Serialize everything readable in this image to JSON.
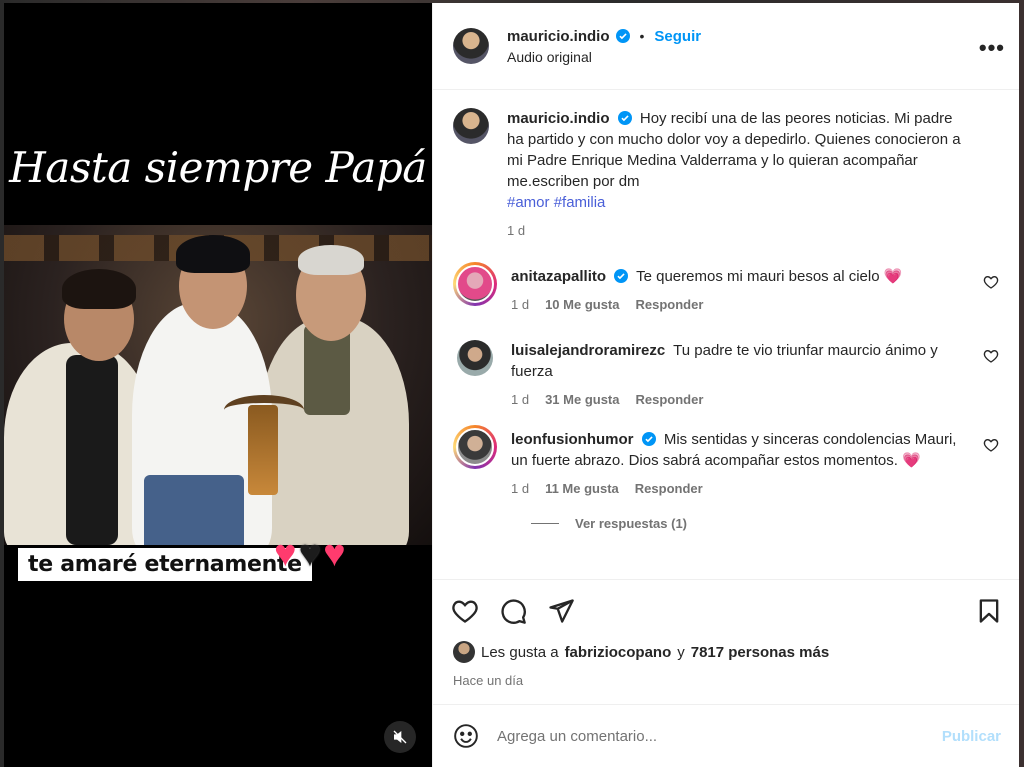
{
  "media": {
    "title": "Hasta siempre Papá",
    "caption_strip": "te amaré eternamente",
    "hearts": [
      "♥",
      "♥",
      "♥"
    ],
    "heart_colors": [
      "#ff3b6e",
      "#1c1c1c",
      "#ff3b6e"
    ]
  },
  "header": {
    "username": "mauricio.indio",
    "follow_label": "Seguir",
    "subline": "Audio original",
    "more_label": "•••"
  },
  "post": {
    "username": "mauricio.indio",
    "text": "Hoy recibí una de las peores noticias. Mi padre ha partido y con mucho dolor voy a depedirlo. Quienes conocieron a mi Padre Enrique Medina Valderrama y lo quieran acompañar me.escriben por dm",
    "tags": [
      "#amor",
      "#familia"
    ],
    "time": "1 d"
  },
  "comments": [
    {
      "username": "anitazapallito",
      "verified": true,
      "text": "Te queremos mi mauri besos al cielo",
      "emoji": "💗",
      "time": "1 d",
      "likes": "10 Me gusta",
      "reply": "Responder"
    },
    {
      "username": "luisalejandroramirezc",
      "verified": false,
      "text": "Tu padre te vio triunfar maurcio ánimo y fuerza",
      "emoji": "",
      "time": "1 d",
      "likes": "31 Me gusta",
      "reply": "Responder"
    },
    {
      "username": "leonfusionhumor",
      "verified": true,
      "text": "Mis sentidas y sinceras condolencias Mauri, un fuerte abrazo. Dios sabrá acompañar estos momentos.",
      "emoji": "💗",
      "time": "1 d",
      "likes": "11 Me gusta",
      "reply": "Responder"
    }
  ],
  "view_replies": "Ver respuestas (1)",
  "likes": {
    "prefix": "Les gusta a",
    "user": "fabriziocopano",
    "connector": "y",
    "others": "7817 personas más"
  },
  "time_ago": "Hace un día",
  "compose": {
    "placeholder": "Agrega un comentario...",
    "publish_label": "Publicar"
  },
  "colors": {
    "accent": "#0095f6",
    "verified": "#0095f6",
    "tag": "#4a5fd8",
    "heart": "#ff3b6e"
  }
}
